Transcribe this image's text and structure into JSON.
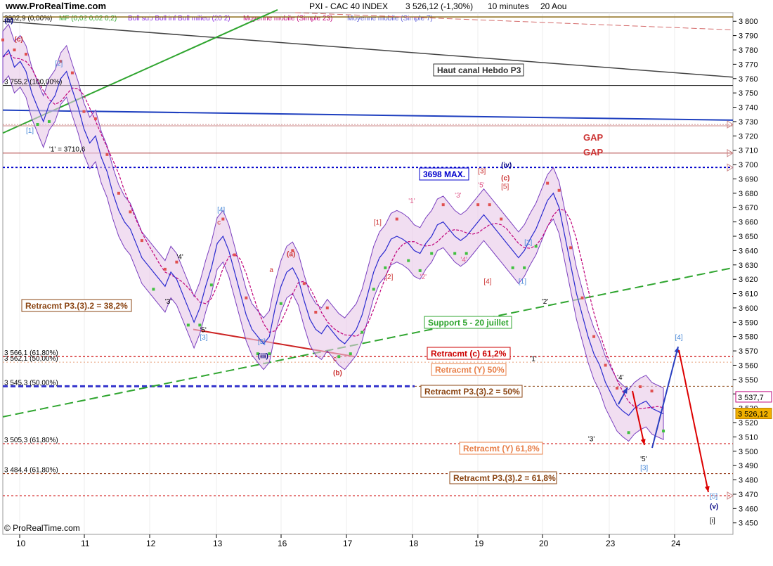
{
  "header": {
    "site": "www.ProRealTime.com",
    "instrument": "PXI - CAC 40 INDEX",
    "price_change": "3 526,12 (-1,30%)",
    "timeframe": "10 minutes",
    "date": "20 Aou"
  },
  "legend": {
    "prefix": "3802,9 (0,00%)",
    "items": [
      {
        "text": "MF (0,02 0,02 0,2)",
        "color": "#2fa52f"
      },
      {
        "text": "Boll sup Boll inf Boll milieu (20 2)",
        "color": "#8a2be2"
      },
      {
        "text": "Moyenne mobile (Simple 23)",
        "color": "#c0007a"
      },
      {
        "text": "Moyenne mobile (Simple 7)",
        "color": "#5a5ad8"
      }
    ]
  },
  "footer": {
    "copyright": "© ProRealTime.com"
  },
  "chart_data": {
    "type": "line",
    "title": "PXI - CAC 40 INDEX",
    "ylim": [
      3442,
      3806
    ],
    "y_ticks": [
      3450,
      3460,
      3470,
      3480,
      3490,
      3500,
      3510,
      3520,
      3530,
      3540,
      3550,
      3560,
      3570,
      3580,
      3590,
      3600,
      3610,
      3620,
      3630,
      3640,
      3650,
      3660,
      3670,
      3680,
      3690,
      3700,
      3710,
      3720,
      3730,
      3740,
      3750,
      3760,
      3770,
      3780,
      3790,
      3800
    ],
    "x_ticks": [
      "10",
      "11",
      "12",
      "13",
      "16",
      "17",
      "18",
      "19",
      "20",
      "23",
      "24"
    ],
    "price_series": [
      [
        0,
        3775
      ],
      [
        1,
        3780
      ],
      [
        2,
        3768
      ],
      [
        3,
        3772
      ],
      [
        4,
        3765
      ],
      [
        5,
        3750
      ],
      [
        6,
        3740
      ],
      [
        7,
        3730
      ],
      [
        8,
        3742
      ],
      [
        9,
        3748
      ],
      [
        10,
        3760
      ],
      [
        11,
        3765
      ],
      [
        12,
        3752
      ],
      [
        13,
        3740
      ],
      [
        14,
        3725
      ],
      [
        15,
        3715
      ],
      [
        16,
        3720
      ],
      [
        17,
        3705
      ],
      [
        18,
        3695
      ],
      [
        19,
        3680
      ],
      [
        20,
        3668
      ],
      [
        21,
        3660
      ],
      [
        22,
        3655
      ],
      [
        23,
        3645
      ],
      [
        24,
        3635
      ],
      [
        25,
        3630
      ],
      [
        26,
        3625
      ],
      [
        27,
        3620
      ],
      [
        28,
        3615
      ],
      [
        29,
        3625
      ],
      [
        30,
        3620
      ],
      [
        31,
        3610
      ],
      [
        32,
        3600
      ],
      [
        33,
        3590
      ],
      [
        34,
        3600
      ],
      [
        35,
        3615
      ],
      [
        36,
        3628
      ],
      [
        37,
        3645
      ],
      [
        38,
        3650
      ],
      [
        39,
        3640
      ],
      [
        40,
        3625
      ],
      [
        41,
        3610
      ],
      [
        42,
        3595
      ],
      [
        43,
        3585
      ],
      [
        44,
        3580
      ],
      [
        45,
        3575
      ],
      [
        46,
        3580
      ],
      [
        47,
        3600
      ],
      [
        48,
        3615
      ],
      [
        49,
        3625
      ],
      [
        50,
        3628
      ],
      [
        51,
        3620
      ],
      [
        52,
        3605
      ],
      [
        53,
        3592
      ],
      [
        54,
        3585
      ],
      [
        55,
        3582
      ],
      [
        56,
        3588
      ],
      [
        57,
        3583
      ],
      [
        58,
        3578
      ],
      [
        59,
        3575
      ],
      [
        60,
        3580
      ],
      [
        61,
        3585
      ],
      [
        62,
        3595
      ],
      [
        63,
        3610
      ],
      [
        64,
        3625
      ],
      [
        65,
        3635
      ],
      [
        66,
        3640
      ],
      [
        67,
        3648
      ],
      [
        68,
        3650
      ],
      [
        69,
        3648
      ],
      [
        70,
        3645
      ],
      [
        71,
        3640
      ],
      [
        72,
        3638
      ],
      [
        73,
        3645
      ],
      [
        74,
        3650
      ],
      [
        75,
        3658
      ],
      [
        76,
        3660
      ],
      [
        77,
        3655
      ],
      [
        78,
        3650
      ],
      [
        79,
        3647
      ],
      [
        80,
        3650
      ],
      [
        81,
        3655
      ],
      [
        82,
        3660
      ],
      [
        83,
        3665
      ],
      [
        84,
        3660
      ],
      [
        85,
        3655
      ],
      [
        86,
        3650
      ],
      [
        87,
        3645
      ],
      [
        88,
        3640
      ],
      [
        89,
        3635
      ],
      [
        90,
        3640
      ],
      [
        91,
        3648
      ],
      [
        92,
        3655
      ],
      [
        93,
        3665
      ],
      [
        94,
        3675
      ],
      [
        95,
        3680
      ],
      [
        96,
        3670
      ],
      [
        97,
        3650
      ],
      [
        98,
        3630
      ],
      [
        99,
        3610
      ],
      [
        100,
        3595
      ],
      [
        101,
        3580
      ],
      [
        102,
        3568
      ],
      [
        103,
        3560
      ],
      [
        104,
        3548
      ],
      [
        105,
        3540
      ],
      [
        106,
        3532
      ],
      [
        107,
        3528
      ],
      [
        108,
        3525
      ],
      [
        109,
        3530
      ],
      [
        110,
        3533
      ],
      [
        111,
        3535
      ],
      [
        112,
        3530
      ],
      [
        113,
        3528
      ],
      [
        114,
        3526.12
      ]
    ],
    "wave_labels": [
      {
        "text": "(ii)",
        "x": 0.3,
        "y": 3799,
        "color": "#000080"
      },
      {
        "text": "(c)",
        "x": 2,
        "y": 3786,
        "color": "#cc3333"
      },
      {
        "text": "[2]",
        "x": 9,
        "y": 3769,
        "color": "#4a8ad8"
      },
      {
        "text": "3 755,2 (100,00%)",
        "x": 0,
        "y": 3756,
        "color": "#000"
      },
      {
        "text": "[1]",
        "x": 4,
        "y": 3722,
        "color": "#4a8ad8"
      },
      {
        "text": "'1' = 3710,6",
        "x": 8,
        "y": 3709,
        "color": "#000"
      },
      {
        "text": "[4]",
        "x": 37,
        "y": 3667,
        "color": "#4a8ad8"
      },
      {
        "text": "c",
        "x": 37,
        "y": 3658,
        "color": "#cc3333"
      },
      {
        "text": "'4'",
        "x": 30,
        "y": 3634,
        "color": "#000"
      },
      {
        "text": "'3'",
        "x": 28,
        "y": 3603,
        "color": "#000"
      },
      {
        "text": "'5'",
        "x": 34,
        "y": 3583,
        "color": "#000"
      },
      {
        "text": "[3]",
        "x": 34,
        "y": 3578,
        "color": "#4a8ad8"
      },
      {
        "text": "(a)",
        "x": 49,
        "y": 3636,
        "color": "#cc3333"
      },
      {
        "text": "a",
        "x": 46,
        "y": 3625,
        "color": "#cc3333"
      },
      {
        "text": "[5]",
        "x": 44,
        "y": 3575,
        "color": "#4a8ad8"
      },
      {
        "text": "(iii)",
        "x": 44,
        "y": 3565,
        "color": "#000080"
      },
      {
        "text": "c",
        "x": 57,
        "y": 3563,
        "color": "#cc3333"
      },
      {
        "text": "(b)",
        "x": 57,
        "y": 3553,
        "color": "#cc3333"
      },
      {
        "text": "[1]",
        "x": 64,
        "y": 3658,
        "color": "#cc3333"
      },
      {
        "text": "'1'",
        "x": 70,
        "y": 3673,
        "color": "#e05a8a"
      },
      {
        "text": "[2]",
        "x": 66,
        "y": 3620,
        "color": "#cc3333"
      },
      {
        "text": "'2'",
        "x": 72,
        "y": 3620,
        "color": "#e05a8a"
      },
      {
        "text": "'3'",
        "x": 78,
        "y": 3677,
        "color": "#e05a8a"
      },
      {
        "text": "'4'",
        "x": 79,
        "y": 3632,
        "color": "#e05a8a"
      },
      {
        "text": "[3]",
        "x": 82,
        "y": 3694,
        "color": "#cc3333"
      },
      {
        "text": "'5'",
        "x": 82,
        "y": 3684,
        "color": "#e05a8a"
      },
      {
        "text": "[4]",
        "x": 83,
        "y": 3617,
        "color": "#cc3333"
      },
      {
        "text": "(iv)",
        "x": 86,
        "y": 3698,
        "color": "#000080"
      },
      {
        "text": "(c)",
        "x": 86,
        "y": 3689,
        "color": "#cc3333"
      },
      {
        "text": "[5]",
        "x": 86,
        "y": 3683,
        "color": "#cc3333"
      },
      {
        "text": "[2]",
        "x": 90,
        "y": 3644,
        "color": "#4a8ad8"
      },
      {
        "text": "[1]",
        "x": 89,
        "y": 3617,
        "color": "#4a8ad8"
      },
      {
        "text": "'2'",
        "x": 93,
        "y": 3603,
        "color": "#000"
      },
      {
        "text": "'1'",
        "x": 91,
        "y": 3563,
        "color": "#000"
      },
      {
        "text": "'3'",
        "x": 101,
        "y": 3507,
        "color": "#000"
      },
      {
        "text": "'4'",
        "x": 106,
        "y": 3550,
        "color": "#000"
      },
      {
        "text": "'5'",
        "x": 110,
        "y": 3493,
        "color": "#000"
      },
      {
        "text": "[3]",
        "x": 110,
        "y": 3487,
        "color": "#4a8ad8"
      },
      {
        "text": "[4]",
        "x": 116,
        "y": 3578,
        "color": "#4a8ad8"
      },
      {
        "text": "[5]",
        "x": 122,
        "y": 3467,
        "color": "#4a8ad8"
      },
      {
        "text": "(v)",
        "x": 122,
        "y": 3460,
        "color": "#000080"
      },
      {
        "text": "[i]",
        "x": 122,
        "y": 3450,
        "color": "#000"
      }
    ],
    "horizontal_levels": [
      {
        "value": 3755.2,
        "label": "3 755,2 (100,00%)",
        "color": "#333"
      },
      {
        "value": 3698,
        "label": "3698 MAX.",
        "color": "#0000cc"
      },
      {
        "value": 3566.1,
        "label": "3 566,1 (61,80%)",
        "color": "#cc0000"
      },
      {
        "value": 3562.1,
        "label": "3 562,1 (50,00%)",
        "color": "#e8a07a"
      },
      {
        "value": 3545.3,
        "label": "3 545,3 (50,00%)",
        "color": "#3333cc"
      },
      {
        "value": 3505.3,
        "label": "3 505,3 (61,80%)",
        "color": "#cc0000"
      },
      {
        "value": 3484.4,
        "label": "3 484,4 (61,80%)",
        "color": "#8b2500"
      }
    ],
    "annotations": [
      {
        "text": "Haut canal Hebdo P3",
        "color": "#333"
      },
      {
        "text": "GAP",
        "color": "#cc3333"
      },
      {
        "text": "GAP",
        "color": "#cc3333"
      },
      {
        "text": "3698 MAX.",
        "color": "#0000cc"
      },
      {
        "text": "Retracmt P3.(3).2 = 38,2%",
        "color": "#8b4513"
      },
      {
        "text": "Support 5 - 20 juillet",
        "color": "#2fa52f"
      },
      {
        "text": "Retracmt (c) 61,2%",
        "color": "#cc0000"
      },
      {
        "text": "Retracmt (Y) 50%",
        "color": "#e8804a"
      },
      {
        "text": "Retracmt P3.(3).2 = 50%",
        "color": "#8b4513"
      },
      {
        "text": "Retracmt (Y) 61,8%",
        "color": "#e8804a"
      },
      {
        "text": "Retracmt P3.(3).2 = 61,8%",
        "color": "#8b4513"
      }
    ],
    "price_tags": [
      {
        "text": "3 537,7",
        "color": "#c0007a"
      },
      {
        "text": "3 526,12",
        "color": "#f0b000"
      }
    ]
  }
}
